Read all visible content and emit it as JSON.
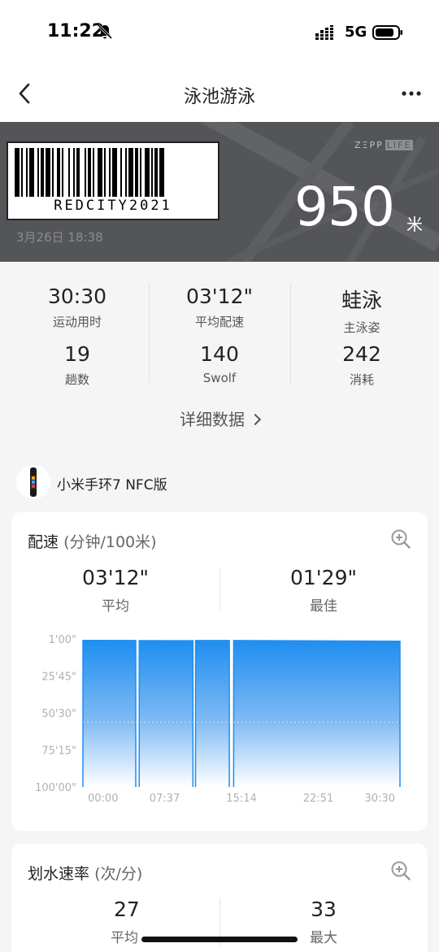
{
  "status": {
    "time": "11:22",
    "network": "5G"
  },
  "nav": {
    "title": "泳池游泳"
  },
  "hero": {
    "barcode_text": "REDCITY2021",
    "date": "3月26日 18:38",
    "logo_left": "ZΞPP",
    "logo_right": "LIFE",
    "distance": "950",
    "distance_unit": "米"
  },
  "stats": [
    {
      "value": "30:30",
      "label": "运动用时"
    },
    {
      "value": "03'12\"",
      "label": "平均配速"
    },
    {
      "value": "蛙泳",
      "label": "主泳姿"
    },
    {
      "value": "19",
      "label": "趟数"
    },
    {
      "value": "140",
      "label": "Swolf"
    },
    {
      "value": "242",
      "label": "消耗"
    }
  ],
  "detail_link": "详细数据",
  "device": {
    "name": "小米手环7 NFC版"
  },
  "pace_card": {
    "title": "配速",
    "title_sub": "(分钟/100米)",
    "avg_value": "03'12\"",
    "avg_label": "平均",
    "best_value": "01'29\"",
    "best_label": "最佳"
  },
  "stroke_card": {
    "title": "划水速率",
    "title_sub": "(次/分)",
    "avg_value": "27",
    "avg_label": "平均",
    "max_value": "33",
    "max_label": "最大"
  },
  "colors": {
    "accent": "#1e8ef0",
    "hero_bg": "#555659"
  },
  "chart_data": {
    "type": "area",
    "title": "",
    "xlabel": "",
    "ylabel": "",
    "x_ticks": [
      "00:00",
      "07:37",
      "15:14",
      "22:51",
      "30:30"
    ],
    "y_ticks": [
      "1'00\"",
      "25'45\"",
      "50'30\"",
      "75'15\"",
      "100'00\""
    ],
    "x_range_seconds": [
      0,
      1830
    ],
    "y_range_seconds_per_100m": [
      60,
      6000
    ],
    "y_inverted": true,
    "average_line_seconds": 192,
    "grid": false,
    "segments": [
      {
        "x": [
          0,
          305
        ],
        "y": [
          93,
          95
        ]
      },
      {
        "x": [
          325,
          635
        ],
        "y": [
          102,
          104
        ]
      },
      {
        "x": [
          650,
          845
        ],
        "y": [
          96,
          98
        ]
      },
      {
        "x": [
          870,
          1830
        ],
        "y": [
          96,
          125
        ]
      }
    ]
  }
}
